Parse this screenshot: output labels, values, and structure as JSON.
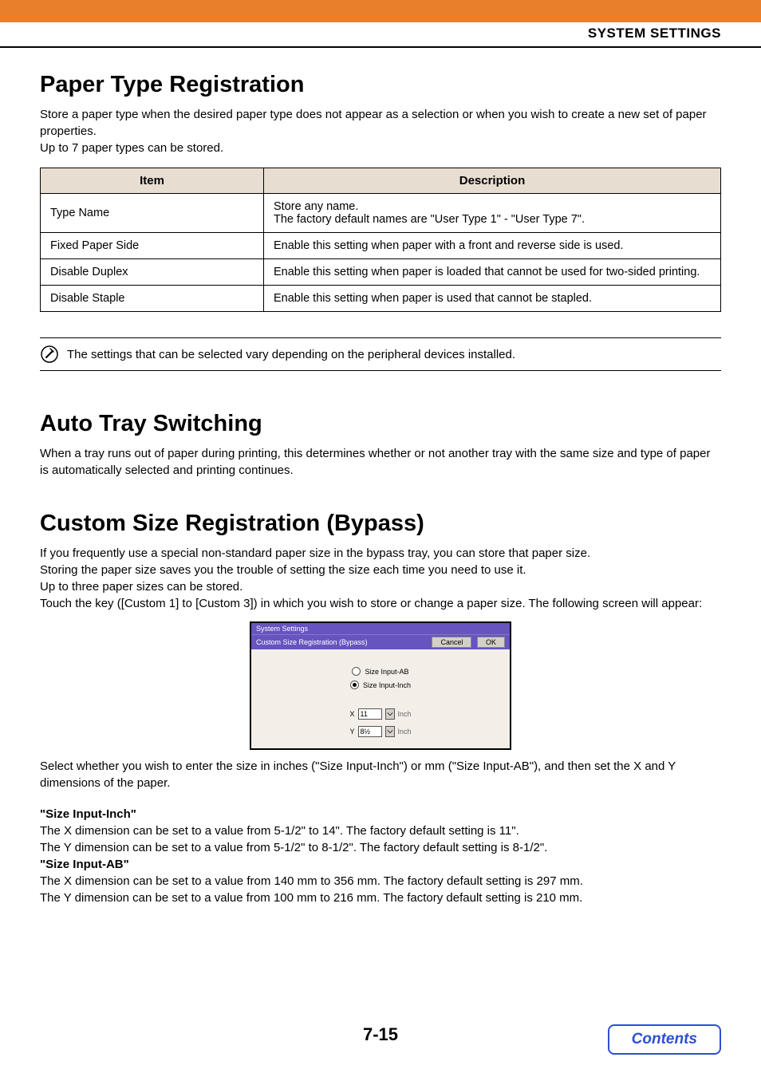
{
  "header": {
    "title": "SYSTEM SETTINGS"
  },
  "sections": {
    "paper_type": {
      "heading": "Paper Type Registration",
      "intro1": "Store a paper type when the desired paper type does not appear as a selection or when you wish to create a new set of paper properties.",
      "intro2": "Up to 7 paper types can be stored.",
      "th_item": "Item",
      "th_desc": "Description",
      "rows": [
        {
          "item": "Type Name",
          "desc": "Store any name.\nThe factory default names are \"User Type 1\" - \"User Type 7\"."
        },
        {
          "item": "Fixed Paper Side",
          "desc": "Enable this setting when paper with a front and reverse side is used."
        },
        {
          "item": "Disable Duplex",
          "desc": "Enable this setting when paper is loaded that cannot be used for two-sided printing."
        },
        {
          "item": "Disable Staple",
          "desc": "Enable this setting when paper is used that cannot be stapled."
        }
      ],
      "note": "The settings that can be selected vary depending on the peripheral devices installed."
    },
    "auto_tray": {
      "heading": "Auto Tray Switching",
      "body": "When a tray runs out of paper during printing, this determines whether or not another tray with the same size and type of paper is automatically selected and printing continues."
    },
    "custom_size": {
      "heading": "Custom Size Registration (Bypass)",
      "p1": "If you frequently use a special non-standard paper size in the bypass tray, you can store that paper size.",
      "p2": "Storing the paper size saves you the trouble of setting the size each time you need to use it.",
      "p3": "Up to three paper sizes can be stored.",
      "p4": "Touch the key ([Custom 1] to [Custom 3]) in which you wish to store or change a paper size. The following screen will appear:",
      "dialog": {
        "title": "System Settings",
        "subtitle": "Custom Size Registration (Bypass)",
        "cancel": "Cancel",
        "ok": "OK",
        "radio_ab": "Size Input-AB",
        "radio_inch": "Size Input-Inch",
        "x_label": "X",
        "x_val": "11",
        "y_label": "Y",
        "y_val": "8½",
        "unit": "Inch"
      },
      "after_dialog": "Select whether you wish to enter the size in inches (\"Size Input-Inch\") or mm (\"Size Input-AB\"), and then set the X and Y dimensions of the paper.",
      "inch_head": "\"Size Input-Inch\"",
      "inch_x": "The X dimension can be set to a value from 5-1/2\" to 14\". The factory default setting is 11\".",
      "inch_y": "The Y dimension can be set to a value from 5-1/2\" to 8-1/2\". The factory default setting is 8-1/2\".",
      "ab_head": "\"Size Input-AB\"",
      "ab_x": "The X dimension can be set to a value from 140 mm to 356 mm. The factory default setting is 297 mm.",
      "ab_y": "The Y dimension can be set to a value from 100 mm to 216 mm. The factory default setting is 210 mm."
    }
  },
  "page_number": "7-15",
  "contents_label": "Contents"
}
